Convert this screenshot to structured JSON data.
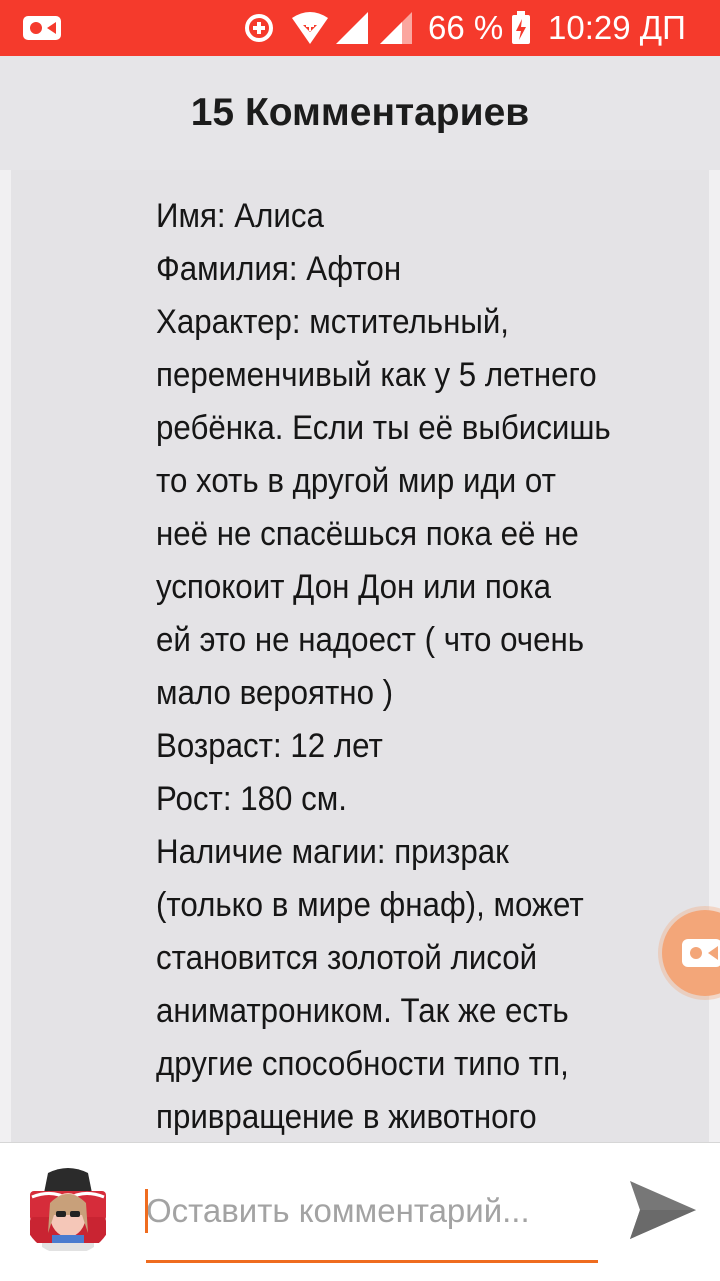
{
  "status_bar": {
    "battery_percent": "66 %",
    "time": "10:29 ДП",
    "background_color": "#f53a2c",
    "icons": [
      "video-recorder-icon",
      "data-saver-icon",
      "wifi-icon",
      "signal-icon",
      "signal-icon",
      "battery-charging-icon"
    ]
  },
  "header": {
    "title": "15 Комментариев"
  },
  "comment": {
    "lines": [
      "Имя: Алиса",
      "Фамилия: Афтон",
      "Характер: мстительный,",
      "переменчивый как у 5 летнего",
      "ребёнка. Если ты её выбисишь",
      "то хоть в другой мир иди от",
      "неё не спасёшься пока её не",
      "успокоит Дон Дон или пока",
      "ей это не надоест ( что очень",
      "мало вероятно )",
      "Возраст: 12 лет",
      "Рост: 180 см.",
      "Наличие магии: призрак",
      "(только в мире фнаф), может",
      "становится золотой лисой",
      "аниматроником. Так же есть",
      "другие способности типо тп,",
      "привращение в животного"
    ]
  },
  "composer": {
    "placeholder": "Оставить комментарий...",
    "value": "",
    "accent_color": "#ef6c1f"
  },
  "icons": {
    "send": "send-icon",
    "floating": "screen-recorder-icon",
    "avatar": "avatar"
  }
}
